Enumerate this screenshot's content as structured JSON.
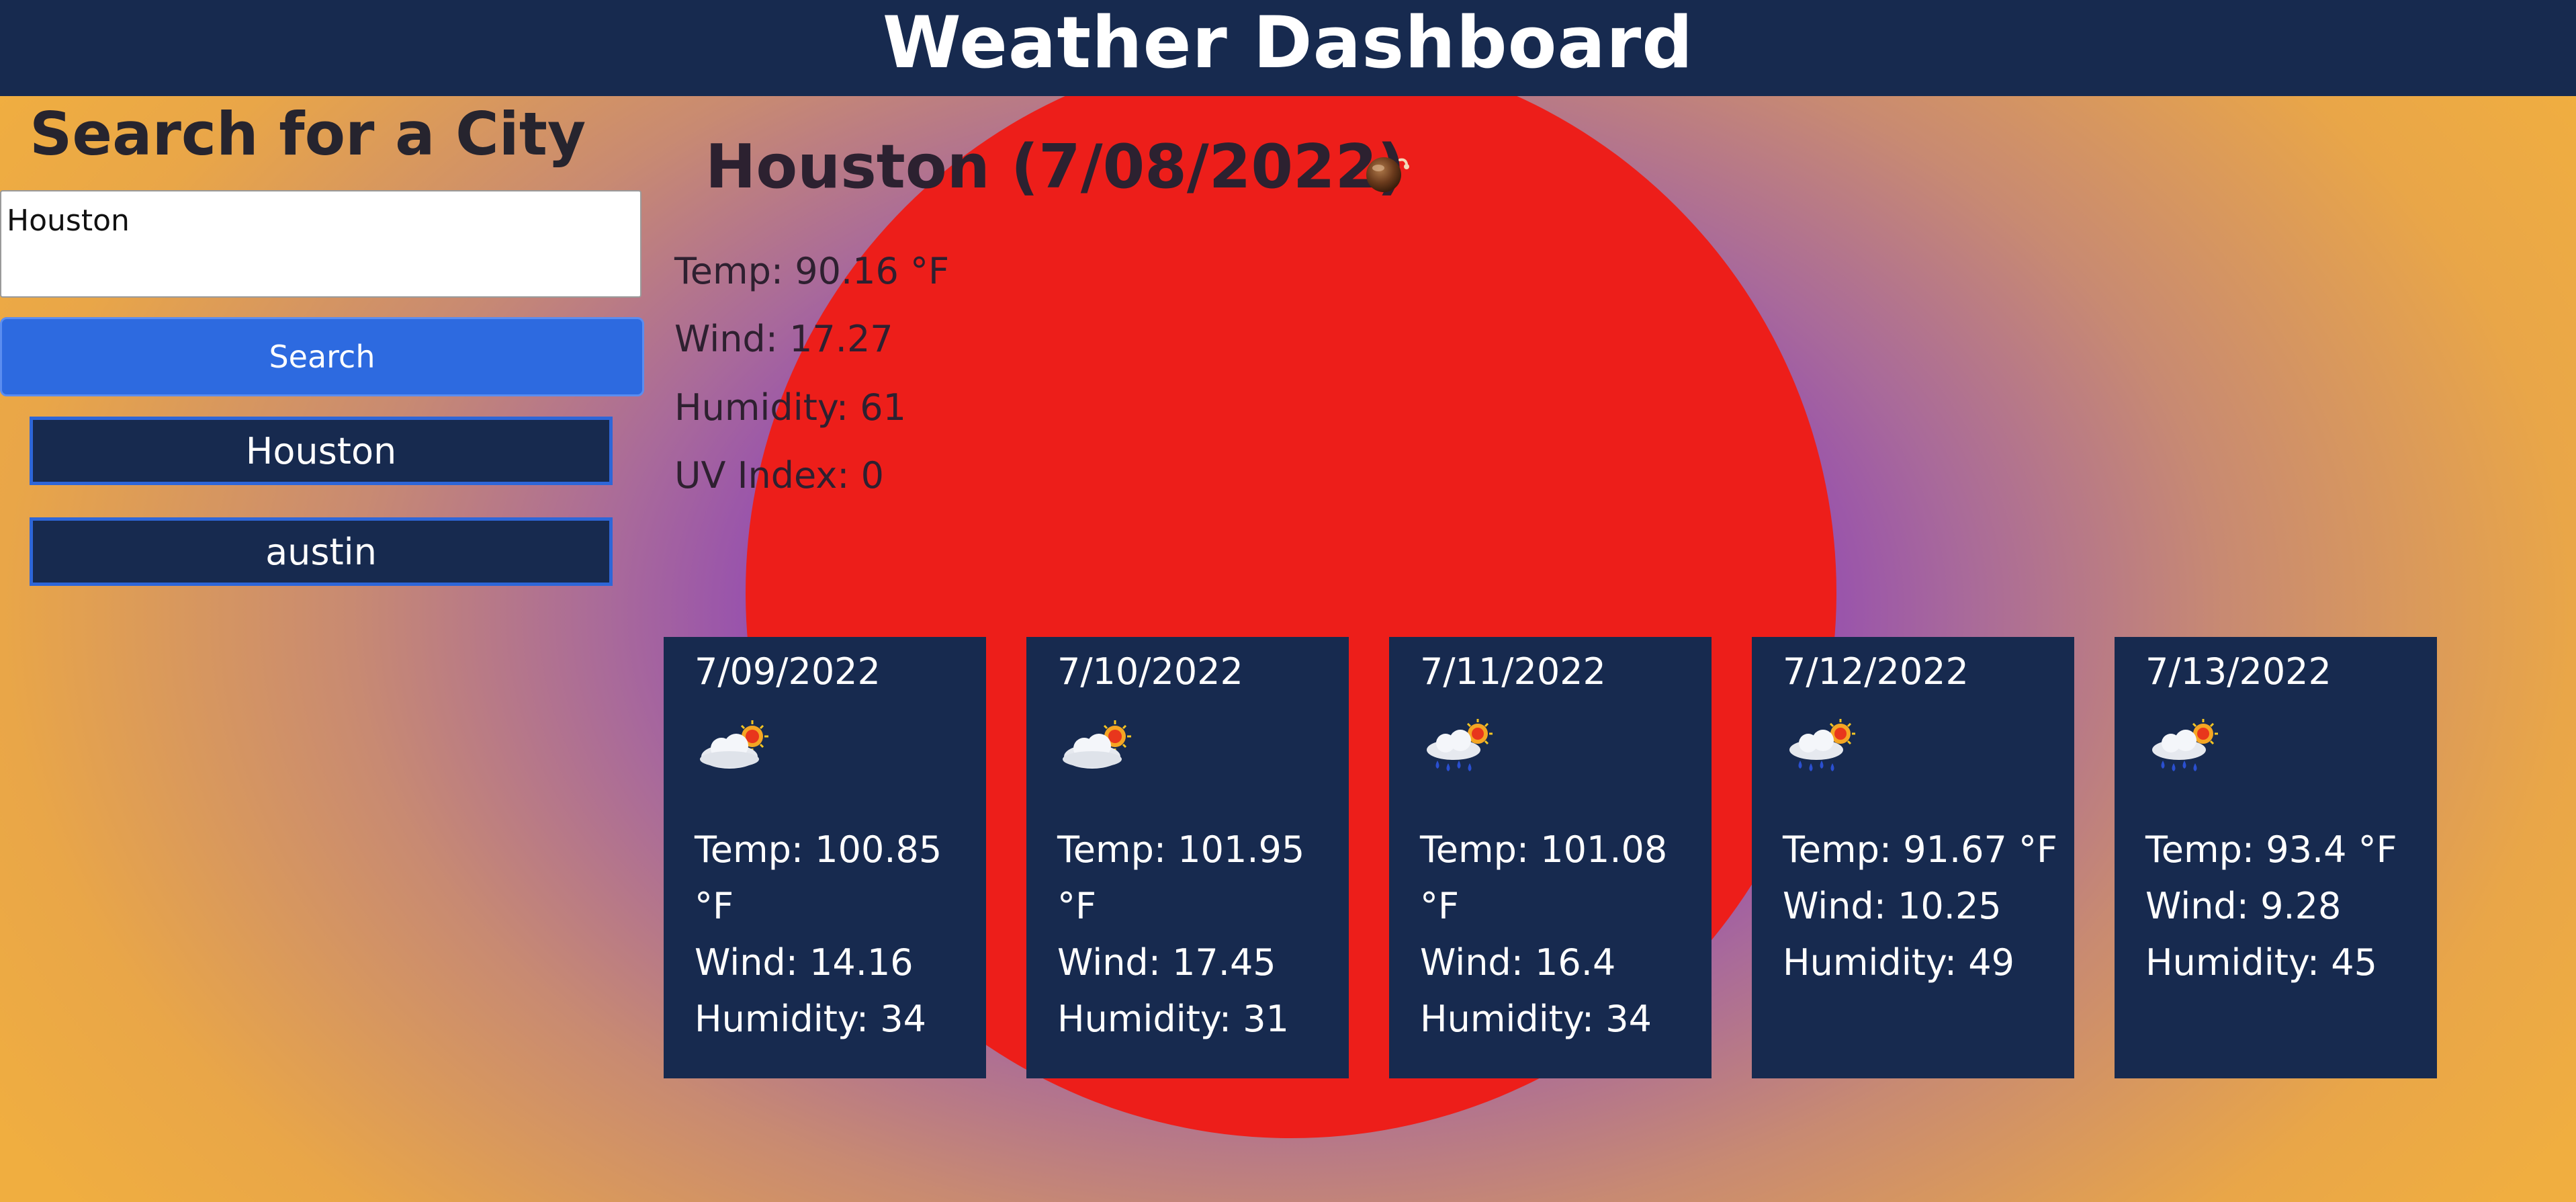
{
  "header": {
    "title": "Weather Dashboard"
  },
  "search": {
    "title": "Search for a City",
    "input_value": "Houston",
    "button_label": "Search",
    "history": [
      "Houston",
      "austin"
    ]
  },
  "current": {
    "title": "Houston (7/08/2022)",
    "icon": "night-cloud-icon",
    "temp": "Temp: 90.16 °F",
    "wind": "Wind: 17.27",
    "humidity": "Humidity: 61",
    "uv": "UV Index: 0"
  },
  "forecast": [
    {
      "date": "7/09/2022",
      "icon": "partly-cloudy-icon",
      "temp": "Temp: 100.85 °F",
      "wind": "Wind: 14.16",
      "humidity": "Humidity: 34"
    },
    {
      "date": "7/10/2022",
      "icon": "partly-cloudy-icon",
      "temp": "Temp: 101.95 °F",
      "wind": "Wind: 17.45",
      "humidity": "Humidity: 31"
    },
    {
      "date": "7/11/2022",
      "icon": "rain-sun-icon",
      "temp": "Temp: 101.08 °F",
      "wind": "Wind: 16.4",
      "humidity": "Humidity: 34"
    },
    {
      "date": "7/12/2022",
      "icon": "rain-sun-icon",
      "temp": "Temp: 91.67 °F",
      "wind": "Wind: 10.25",
      "humidity": "Humidity: 49"
    },
    {
      "date": "7/13/2022",
      "icon": "rain-sun-icon",
      "temp": "Temp: 93.4 °F",
      "wind": "Wind: 9.28",
      "humidity": "Humidity: 45"
    }
  ],
  "colors": {
    "header_bg": "#172a4f",
    "card_bg": "#172a4f",
    "button_blue": "#2d6ae0",
    "sun_red": "#ed1e1a",
    "gradient_center": "#7e38be",
    "gradient_edge": "#f0ae40"
  }
}
